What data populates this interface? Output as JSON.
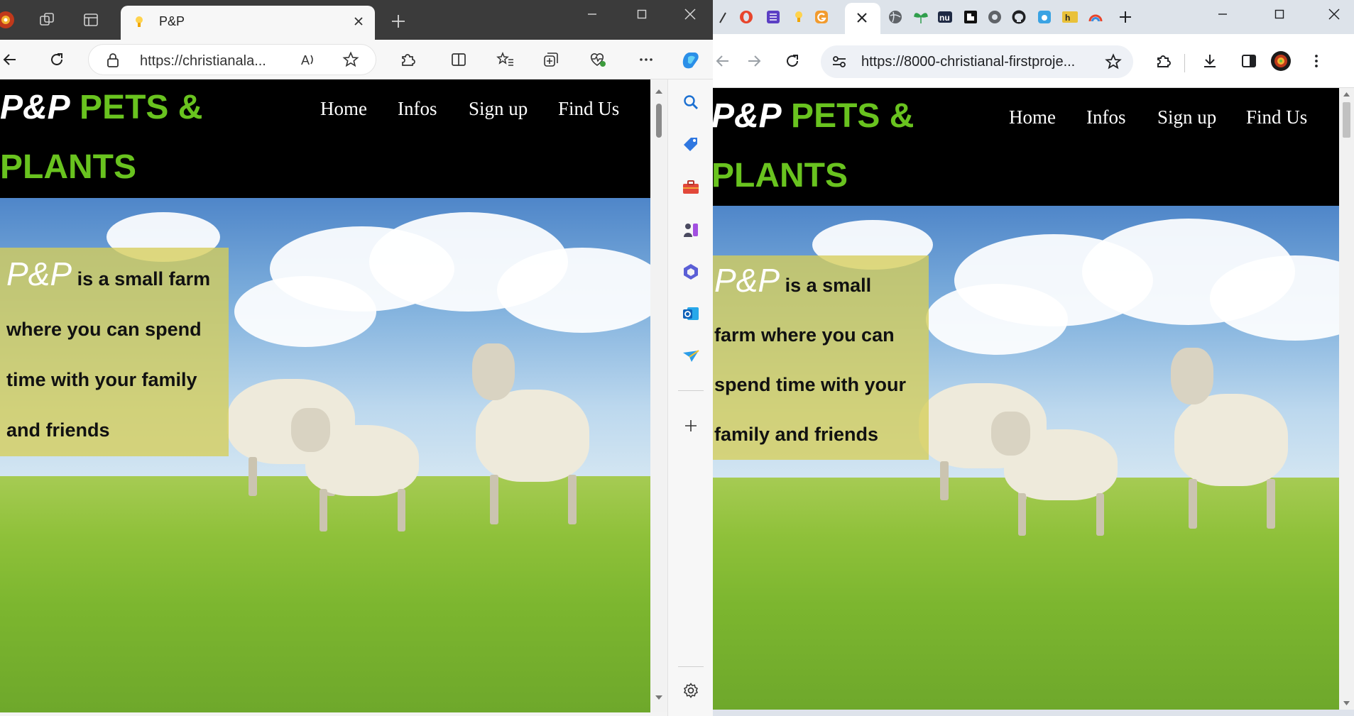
{
  "edge": {
    "tab_title": "P&P",
    "url": "https://christianala...",
    "new_tab_symbol": "+"
  },
  "chrome": {
    "url": "https://8000-christianal-firstproje...",
    "new_tab_symbol": "+"
  },
  "site": {
    "logo_abbr": "P&P",
    "logo_name_line1": "PETS &",
    "logo_name_line2": "PLANTS",
    "nav": [
      "Home",
      "Infos",
      "Sign up",
      "Find Us"
    ],
    "hero_lead": "P&P",
    "hero_text_edge": [
      "is a small farm",
      "where you can spend",
      "time with your family",
      "and friends"
    ],
    "hero_text_chrome": [
      "is a small",
      "farm where you can",
      "spend time with your",
      "family and friends"
    ]
  },
  "colors": {
    "header_bg": "#000000",
    "logo_green": "#69c31f",
    "info_box": "#d6ce5a"
  },
  "icons": {
    "edge_toolbar": [
      "back-icon",
      "refresh-icon",
      "lock-icon",
      "read-aloud-icon",
      "favorite-star-icon",
      "extensions-icon",
      "split-screen-icon",
      "favorites-icon",
      "collections-icon",
      "browser-essentials-icon",
      "more-icon",
      "copilot-icon"
    ],
    "edge_sidebar": [
      "search-icon",
      "shopping-icon",
      "tools-icon",
      "games-icon",
      "microsoft-365-icon",
      "outlook-icon",
      "drop-icon",
      "add-icon",
      "settings-icon"
    ],
    "chrome_toolbar": [
      "back-icon",
      "forward-icon",
      "refresh-icon",
      "site-info-icon",
      "bookmark-star-icon",
      "extensions-icon",
      "download-icon",
      "side-panel-icon",
      "profile-avatar",
      "more-icon"
    ]
  }
}
